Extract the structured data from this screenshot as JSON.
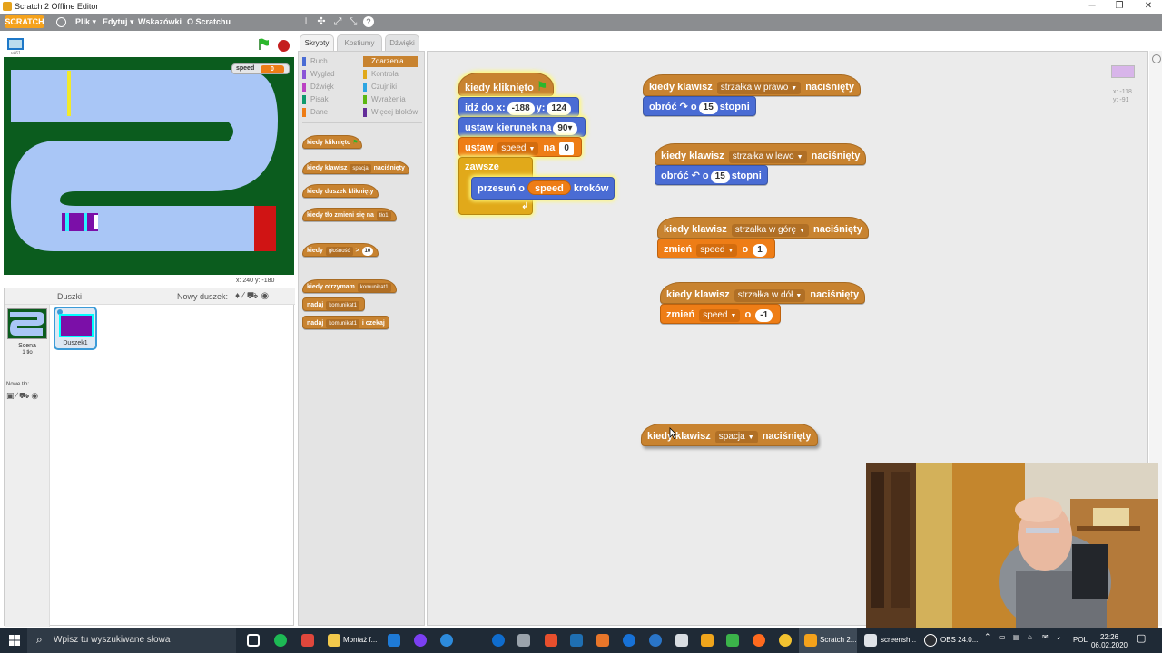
{
  "window": {
    "title": "Scratch 2 Offline Editor",
    "min": "─",
    "max": "❐",
    "close": "✕"
  },
  "menu": {
    "logo": "SCRATCH",
    "file": "Plik ▾",
    "edit": "Edytuj ▾",
    "tips": "Wskazówki",
    "about": "O Scratchu"
  },
  "stage": {
    "version": "v461",
    "monitor_label": "speed",
    "monitor_value": "0",
    "coords": "x: 240   y: -180"
  },
  "sprites": {
    "title": "Duszki",
    "new_sprite": "Nowy duszek:",
    "scene_label": "Scena",
    "scene_sub": "1 tło",
    "new_bg": "Nowe tło:",
    "sprite1": "Duszek1"
  },
  "tabs": {
    "scripts": "Skrypty",
    "costumes": "Kostiumy",
    "sounds": "Dźwięki"
  },
  "categories": {
    "motion": "Ruch",
    "looks": "Wygląd",
    "sound": "Dźwięk",
    "pen": "Pisak",
    "data": "Dane",
    "events": "Zdarzenia",
    "control": "Kontrola",
    "sensing": "Czujniki",
    "operators": "Wyrażenia",
    "more": "Więcej bloków"
  },
  "palette": {
    "flag": "kiedy kliknięto",
    "key_a": "kiedy klawisz",
    "key_b": "spacja",
    "key_c": "naciśnięty",
    "sprite_click": "kiedy duszek kliknięty",
    "bg_a": "kiedy tło zmieni się na",
    "bg_b": "tło1",
    "loud_a": "kiedy",
    "loud_b": "głośność",
    "loud_c": ">",
    "loud_d": "10",
    "recv_a": "kiedy otrzymam",
    "recv_b": "komunikat1",
    "bc_a": "nadaj",
    "bc_b": "komunikat1",
    "bcw_a": "nadaj",
    "bcw_b": "komunikat1",
    "bcw_c": "i czekaj"
  },
  "script1": {
    "hat": "kiedy kliknięto",
    "goto_a": "idź do x:",
    "goto_x": "-188",
    "goto_b": "y:",
    "goto_y": "124",
    "dir_a": "ustaw kierunek na",
    "dir_v": "90▾",
    "set_a": "ustaw",
    "set_var": "speed",
    "set_b": "na",
    "set_v": "0",
    "forever": "zawsze",
    "move_a": "przesuń o",
    "move_var": "speed",
    "move_b": "kroków"
  },
  "script2": {
    "a": "kiedy klawisz",
    "key": "strzałka w prawo",
    "b": "naciśnięty",
    "turn": "obróć",
    "sym": "↷",
    "o": "o",
    "deg": "15",
    "unit": "stopni"
  },
  "script3": {
    "a": "kiedy klawisz",
    "key": "strzałka w lewo",
    "b": "naciśnięty",
    "turn": "obróć",
    "sym": "↶",
    "o": "o",
    "deg": "15",
    "unit": "stopni"
  },
  "script4": {
    "a": "kiedy klawisz",
    "key": "strzałka w górę",
    "b": "naciśnięty",
    "chg": "zmień",
    "var": "speed",
    "o": "o",
    "val": "1"
  },
  "script5": {
    "a": "kiedy klawisz",
    "key": "strzałka w dół",
    "b": "naciśnięty",
    "chg": "zmień",
    "var": "speed",
    "o": "o",
    "val": "-1"
  },
  "script6": {
    "a": "kiedy klawisz",
    "key": "spacja",
    "b": "naciśnięty"
  },
  "mini": {
    "x": "x: -118",
    "y": "y: -91"
  },
  "taskbar": {
    "search": "Wpisz tu wyszukiwane słowa",
    "montaz": "Montaż f...",
    "scratch": "Scratch 2...",
    "screenshot": "screensh...",
    "obs": "OBS 24.0...",
    "lang": "POL",
    "time": "22:26",
    "date": "06.02.2020"
  }
}
